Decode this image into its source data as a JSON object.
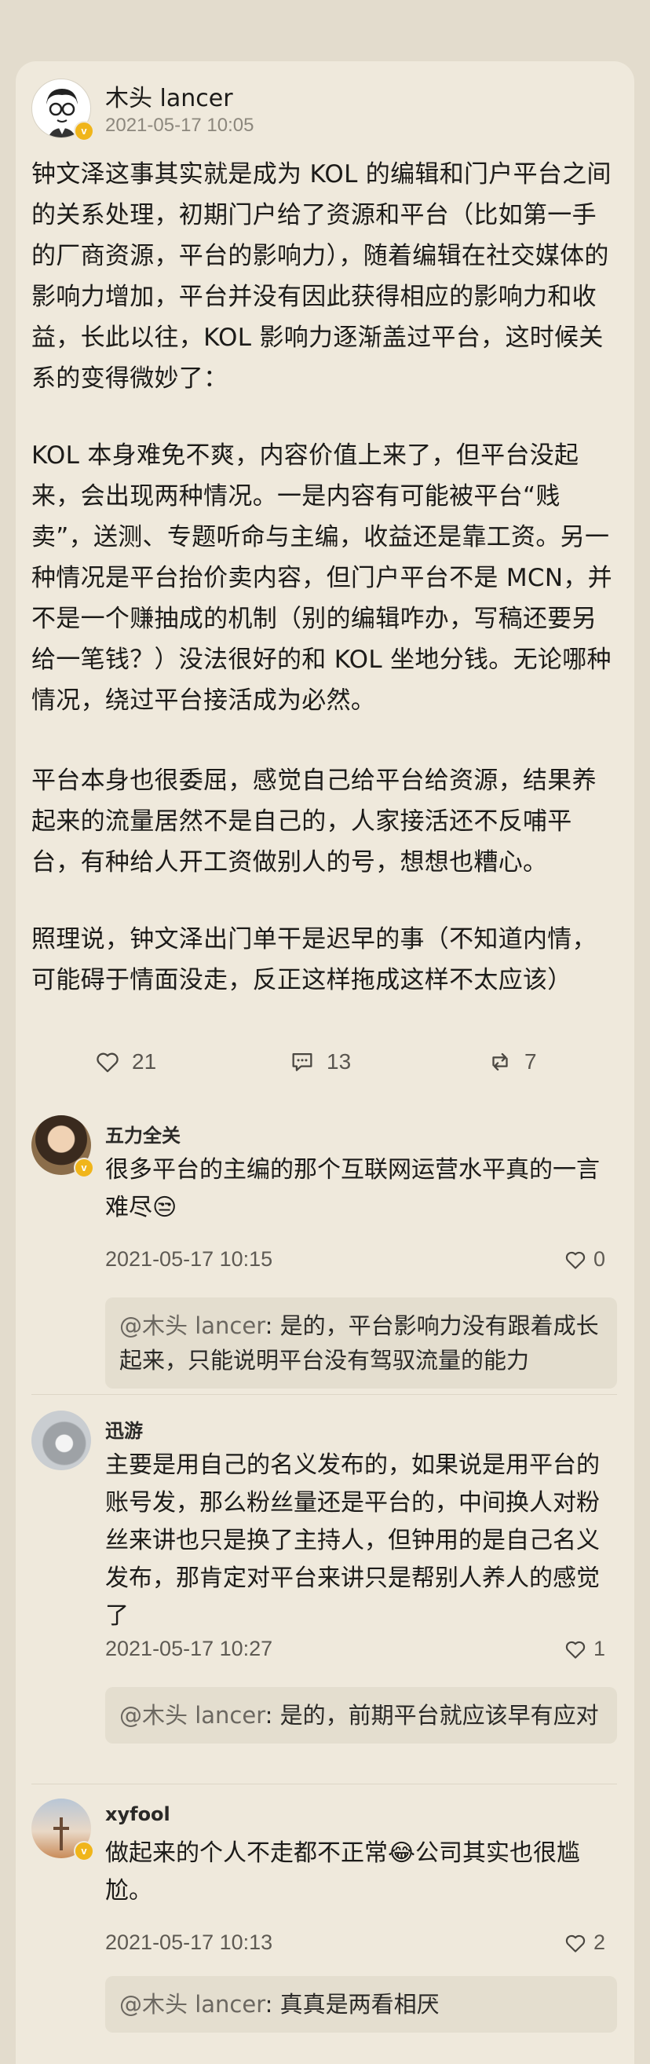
{
  "post": {
    "author": "木头 lancer",
    "time": "2021-05-17 10:05",
    "paragraphs": [
      "钟文泽这事其实就是成为 KOL 的编辑和门户平台之间的关系处理，初期门户给了资源和平台（比如第一手的厂商资源，平台的影响力），随着编辑在社交媒体的影响力增加，平台并没有因此获得相应的影响力和收益，长此以往，KOL 影响力逐渐盖过平台，这时候关系的变得微妙了：",
      "KOL 本身难免不爽，内容价值上来了，但平台没起来，会出现两种情况。一是内容有可能被平台“贱卖”，送测、专题听命与主编，收益还是靠工资。另一种情况是平台抬价卖内容，但门户平台不是 MCN，并不是一个赚抽成的机制（别的编辑咋办，写稿还要另给一笔钱？）没法很好的和 KOL 坐地分钱。无论哪种情况，绕过平台接活成为必然。",
      "平台本身也很委屈，感觉自己给平台给资源，结果养起来的流量居然不是自己的，人家接活还不反哺平台，有种给人开工资做别人的号，想想也糟心。",
      "照理说，钟文泽出门单干是迟早的事（不知道内情，可能碍于情面没走，反正这样拖成这样不太应该）"
    ],
    "actions": {
      "likes": "21",
      "comments": "13",
      "reposts": "7"
    }
  },
  "comments": [
    {
      "author": "五力全关",
      "text": "很多平台的主编的那个互联网运营水平真的一言难尽😒",
      "time": "2021-05-17 10:15",
      "likes": "0",
      "reply_at": "@木头 lancer",
      "reply_text": ": 是的，平台影响力没有跟着成长起来，只能说明平台没有驾驭流量的能力"
    },
    {
      "author": "迅游",
      "text": "主要是用自己的名义发布的，如果说是用平台的账号发，那么粉丝量还是平台的，中间换人对粉丝来讲也只是换了主持人，但钟用的是自己名义发布，那肯定对平台来讲只是帮别人养人的感觉了",
      "time": "2021-05-17 10:27",
      "likes": "1",
      "reply_at": "@木头 lancer",
      "reply_text": ": 是的，前期平台就应该早有应对"
    },
    {
      "author": "xyfool",
      "text": "做起来的个人不走都不正常😂公司其实也很尴尬。",
      "time": "2021-05-17 10:13",
      "likes": "2",
      "reply_at": "@木头 lancer",
      "reply_text": ": 真真是两看相厌"
    }
  ],
  "colors": {
    "background": "#e3dccd",
    "card": "#efe9dc",
    "verified_badge": "#f0b51a",
    "reply_box": "#e4decf"
  },
  "icons": {
    "like": "heart-icon",
    "comment": "comment-icon",
    "repost": "repost-icon",
    "verified": "verified-badge-icon"
  }
}
